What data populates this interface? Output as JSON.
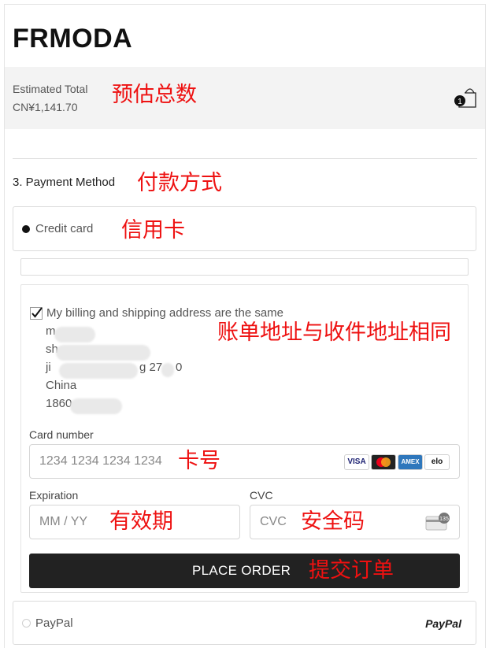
{
  "brand": {
    "name": "FRMODA"
  },
  "summary": {
    "label": "Estimated Total",
    "value": "CN¥1,141.70",
    "annotation": "预估总数",
    "cart_count": "1"
  },
  "payment": {
    "section_title": "3. Payment Method",
    "section_annotation": "付款方式",
    "credit_card": {
      "label": "Credit card",
      "annotation": "信用卡",
      "selected": true
    },
    "billing": {
      "same_address_label": "My billing and shipping address are the same",
      "checked": true,
      "annotation": "账单地址与收件地址相同",
      "address_lines": [
        "m",
        "sh",
        "ji",
        "China",
        "1860"
      ],
      "address_partial": "g 27",
      "address_partial_end": "0"
    },
    "card_number": {
      "label": "Card number",
      "placeholder": "1234 1234 1234 1234",
      "annotation": "卡号",
      "brands": [
        "VISA",
        "mastercard",
        "AMEX",
        "elo"
      ]
    },
    "expiration": {
      "label": "Expiration",
      "placeholder": "MM / YY",
      "annotation": "有效期"
    },
    "cvc": {
      "label": "CVC",
      "placeholder": "CVC",
      "annotation": "安全码",
      "card_icon_text": "135"
    },
    "place_order": {
      "label": "PLACE ORDER",
      "annotation": "提交订单"
    },
    "paypal": {
      "label": "PayPal",
      "logo": "PayPal",
      "selected": false
    }
  },
  "colors": {
    "annotation": "#ee1111",
    "button": "#222222",
    "summary_bg": "#f3f3f3"
  }
}
